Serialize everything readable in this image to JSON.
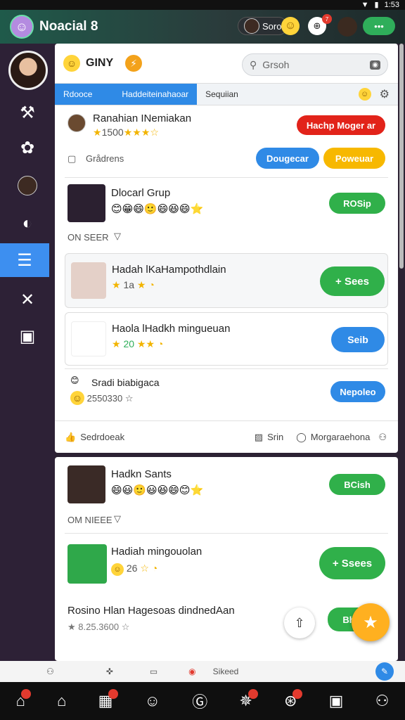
{
  "status": {
    "time": "1:53"
  },
  "appbar": {
    "title": "Noacial 8",
    "user_chip": "Soro",
    "notif_count": "7"
  },
  "sidebar": {
    "items": [
      "pin-icon",
      "bug-icon",
      "user-avatar",
      "chat-icon",
      "document-icon",
      "tools-icon",
      "square-icon"
    ]
  },
  "top": {
    "title": "GINY",
    "search_placeholder": "Grsoh"
  },
  "tabs": [
    "Rdooce",
    "Haddeiteinahaoar",
    "Sequiian"
  ],
  "rows": [
    {
      "title": "Ranahian INemiakan",
      "rating": "1500",
      "button": "Hachp Moger ar"
    },
    {
      "label": "Grådrens",
      "btn1": "Dougecar",
      "btn2": "Poweuar"
    },
    {
      "title": "Dlocarl Grup",
      "button": "ROSip"
    },
    {
      "label": "ON SEER"
    },
    {
      "title": "Hadah lKaHampothdlain",
      "rating": "1a",
      "button": "+ Sees"
    },
    {
      "title": "Haola lHadkh mingueuan",
      "rating": "20",
      "button": "Seib"
    },
    {
      "title": "Sradi biabigaca",
      "rating": "2550330",
      "button": "Nepoleo"
    }
  ],
  "footer": {
    "left": "Sedrdoeak",
    "mid": "Srin",
    "right": "Morgaraehona"
  },
  "second": [
    {
      "title": "Hadkn Sants",
      "button": "BCish"
    },
    {
      "label": "OM NIEEE"
    },
    {
      "title": "Hadiah mingouolan",
      "rating": "26",
      "button": "+ Ssees"
    },
    {
      "title": "Rosino Hlan Hagesoas dindnedAan",
      "rating": "8.25.3600",
      "button": "Bh"
    }
  ],
  "actbar": {
    "label": "Sikeed"
  },
  "navbar": [
    "home-icon",
    "house-icon",
    "grid-icon",
    "smile-icon",
    "g-icon",
    "star-icon",
    "globe-icon",
    "square-icon",
    "user-icon"
  ]
}
